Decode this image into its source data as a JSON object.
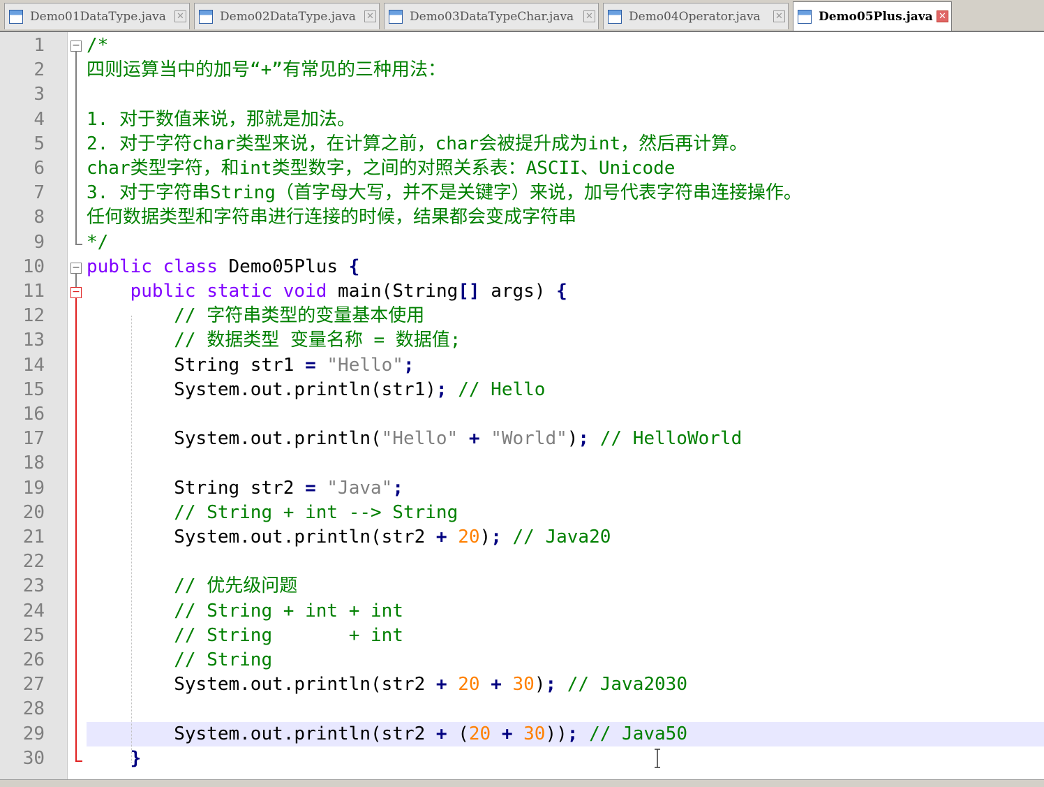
{
  "tabs": [
    {
      "label": "Demo01DataType.java",
      "active": false
    },
    {
      "label": "Demo02DataType.java",
      "active": false
    },
    {
      "label": "Demo03DataTypeChar.java",
      "active": false
    },
    {
      "label": "Demo04Operator.java",
      "active": false
    },
    {
      "label": "Demo05Plus.java",
      "active": true
    }
  ],
  "editor": {
    "current_line": 29,
    "lines": [
      {
        "n": "1",
        "tokens": [
          [
            "c",
            "/*"
          ]
        ]
      },
      {
        "n": "2",
        "tokens": [
          [
            "c",
            "四则运算当中的加号“+”有常见的三种用法："
          ]
        ]
      },
      {
        "n": "3",
        "tokens": []
      },
      {
        "n": "4",
        "tokens": [
          [
            "c",
            "1. 对于数值来说，那就是加法。"
          ]
        ]
      },
      {
        "n": "5",
        "tokens": [
          [
            "c",
            "2. 对于字符char类型来说，在计算之前，char会被提升成为int，然后再计算。"
          ]
        ]
      },
      {
        "n": "6",
        "tokens": [
          [
            "c",
            "char类型字符，和int类型数字，之间的对照关系表：ASCII、Unicode"
          ]
        ]
      },
      {
        "n": "7",
        "tokens": [
          [
            "c",
            "3. 对于字符串String（首字母大写，并不是关键字）来说，加号代表字符串连接操作。"
          ]
        ]
      },
      {
        "n": "8",
        "tokens": [
          [
            "c",
            "任何数据类型和字符串进行连接的时候，结果都会变成字符串"
          ]
        ]
      },
      {
        "n": "9",
        "tokens": [
          [
            "c",
            "*/"
          ]
        ]
      },
      {
        "n": "10",
        "tokens": [
          [
            "k",
            "public"
          ],
          [
            "p",
            " "
          ],
          [
            "k",
            "class"
          ],
          [
            "p",
            " Demo05Plus "
          ],
          [
            "o",
            "{"
          ]
        ]
      },
      {
        "n": "11",
        "tokens": [
          [
            "p",
            "    "
          ],
          [
            "k",
            "public"
          ],
          [
            "p",
            " "
          ],
          [
            "k",
            "static"
          ],
          [
            "p",
            " "
          ],
          [
            "k",
            "void"
          ],
          [
            "p",
            " main(String"
          ],
          [
            "o",
            "[]"
          ],
          [
            "p",
            " args) "
          ],
          [
            "o",
            "{"
          ]
        ]
      },
      {
        "n": "12",
        "tokens": [
          [
            "p",
            "        "
          ],
          [
            "c",
            "// 字符串类型的变量基本使用"
          ]
        ]
      },
      {
        "n": "13",
        "tokens": [
          [
            "p",
            "        "
          ],
          [
            "c",
            "// 数据类型 变量名称 = 数据值;"
          ]
        ]
      },
      {
        "n": "14",
        "tokens": [
          [
            "p",
            "        String str1 "
          ],
          [
            "o",
            "="
          ],
          [
            "p",
            " "
          ],
          [
            "s",
            "\"Hello\""
          ],
          [
            "o",
            ";"
          ]
        ]
      },
      {
        "n": "15",
        "tokens": [
          [
            "p",
            "        System.out.println(str1)"
          ],
          [
            "o",
            ";"
          ],
          [
            "p",
            " "
          ],
          [
            "c",
            "// Hello"
          ]
        ]
      },
      {
        "n": "16",
        "tokens": []
      },
      {
        "n": "17",
        "tokens": [
          [
            "p",
            "        System.out.println("
          ],
          [
            "s",
            "\"Hello\""
          ],
          [
            "p",
            " "
          ],
          [
            "o",
            "+"
          ],
          [
            "p",
            " "
          ],
          [
            "s",
            "\"World\""
          ],
          [
            "p",
            ")"
          ],
          [
            "o",
            ";"
          ],
          [
            "p",
            " "
          ],
          [
            "c",
            "// HelloWorld"
          ]
        ]
      },
      {
        "n": "18",
        "tokens": []
      },
      {
        "n": "19",
        "tokens": [
          [
            "p",
            "        String str2 "
          ],
          [
            "o",
            "="
          ],
          [
            "p",
            " "
          ],
          [
            "s",
            "\"Java\""
          ],
          [
            "o",
            ";"
          ]
        ]
      },
      {
        "n": "20",
        "tokens": [
          [
            "p",
            "        "
          ],
          [
            "c",
            "// String + int --> String"
          ]
        ]
      },
      {
        "n": "21",
        "tokens": [
          [
            "p",
            "        System.out.println(str2 "
          ],
          [
            "o",
            "+"
          ],
          [
            "p",
            " "
          ],
          [
            "n",
            "20"
          ],
          [
            "p",
            ")"
          ],
          [
            "o",
            ";"
          ],
          [
            "p",
            " "
          ],
          [
            "c",
            "// Java20"
          ]
        ]
      },
      {
        "n": "22",
        "tokens": []
      },
      {
        "n": "23",
        "tokens": [
          [
            "p",
            "        "
          ],
          [
            "c",
            "// 优先级问题"
          ]
        ]
      },
      {
        "n": "24",
        "tokens": [
          [
            "p",
            "        "
          ],
          [
            "c",
            "// String + int + int"
          ]
        ]
      },
      {
        "n": "25",
        "tokens": [
          [
            "p",
            "        "
          ],
          [
            "c",
            "// String       + int"
          ]
        ]
      },
      {
        "n": "26",
        "tokens": [
          [
            "p",
            "        "
          ],
          [
            "c",
            "// String"
          ]
        ]
      },
      {
        "n": "27",
        "tokens": [
          [
            "p",
            "        System.out.println(str2 "
          ],
          [
            "o",
            "+"
          ],
          [
            "p",
            " "
          ],
          [
            "n",
            "20"
          ],
          [
            "p",
            " "
          ],
          [
            "o",
            "+"
          ],
          [
            "p",
            " "
          ],
          [
            "n",
            "30"
          ],
          [
            "p",
            ")"
          ],
          [
            "o",
            ";"
          ],
          [
            "p",
            " "
          ],
          [
            "c",
            "// Java2030"
          ]
        ]
      },
      {
        "n": "28",
        "tokens": []
      },
      {
        "n": "29",
        "tokens": [
          [
            "p",
            "        System.out.println(str2 "
          ],
          [
            "o",
            "+"
          ],
          [
            "p",
            " ("
          ],
          [
            "n",
            "20"
          ],
          [
            "p",
            " "
          ],
          [
            "o",
            "+"
          ],
          [
            "p",
            " "
          ],
          [
            "n",
            "30"
          ],
          [
            "p",
            "))"
          ],
          [
            "o",
            ";"
          ],
          [
            "p",
            " "
          ],
          [
            "c",
            "// Java50"
          ]
        ]
      },
      {
        "n": "30",
        "tokens": [
          [
            "p",
            "    "
          ],
          [
            "o",
            "}"
          ]
        ]
      }
    ]
  },
  "colors": {
    "comment": "#008000",
    "keyword": "#8000ff",
    "string": "#808080",
    "number": "#ff8000",
    "operator": "#000080",
    "current_line_bg": "#e8e8ff"
  }
}
